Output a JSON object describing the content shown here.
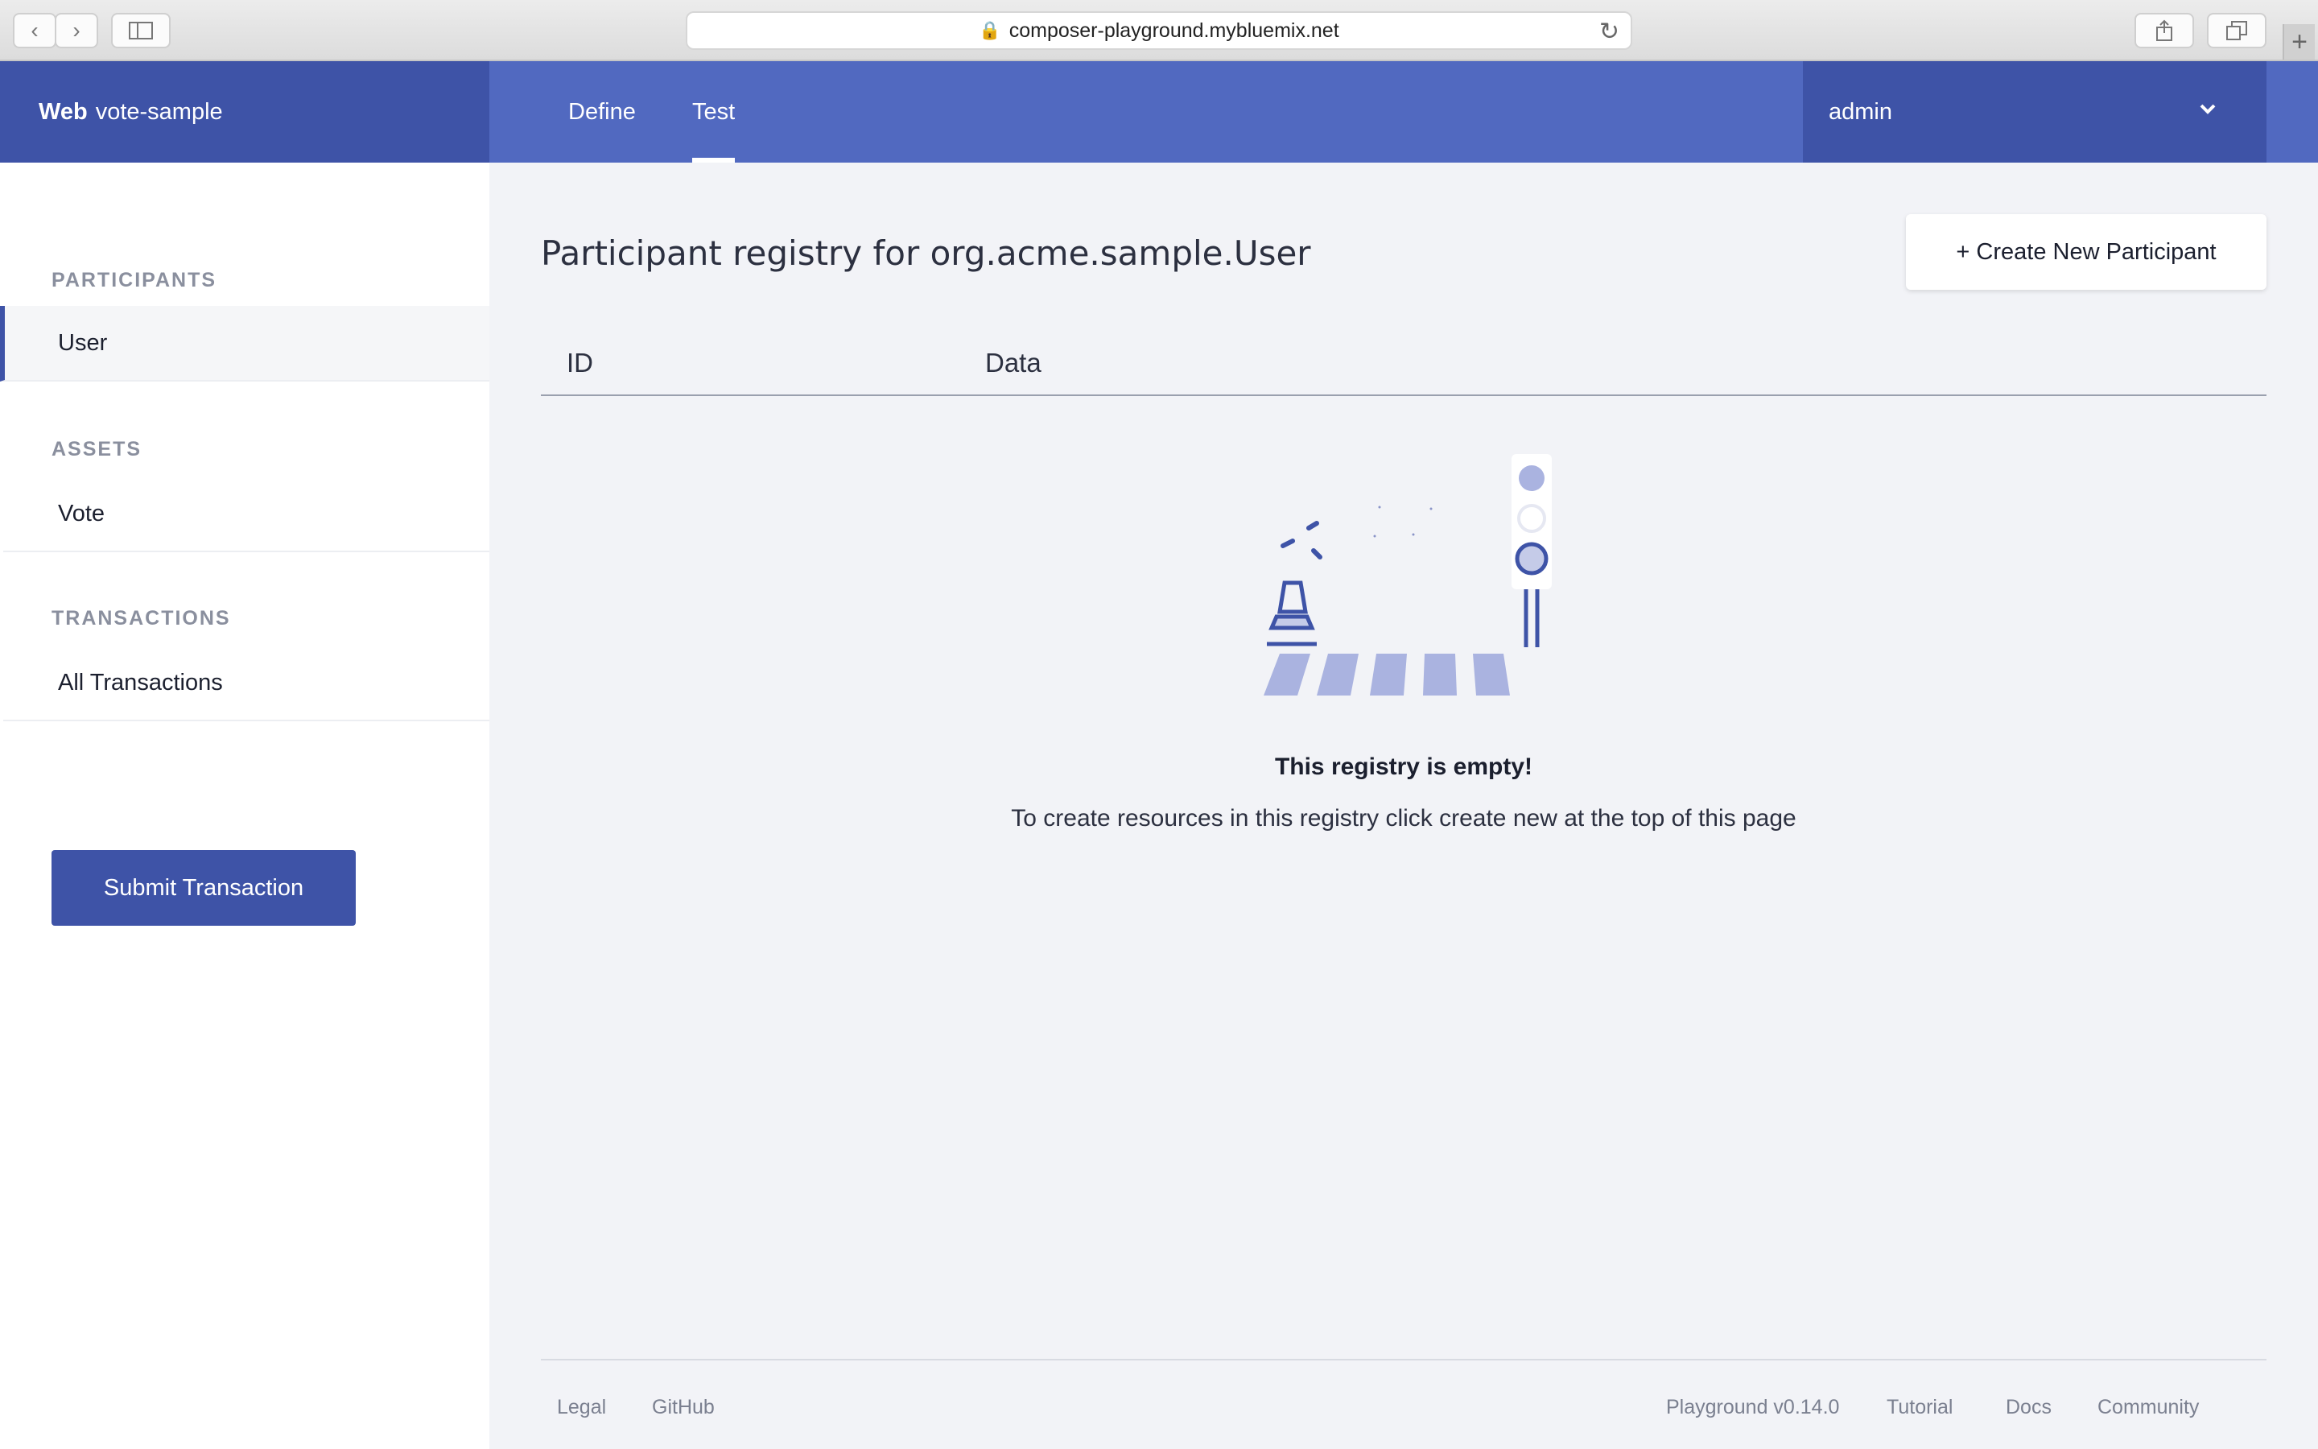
{
  "browser": {
    "url": "composer-playground.mybluemix.net",
    "back_icon": "chevron-left-icon",
    "forward_icon": "chevron-right-icon",
    "sidebar_icon": "sidebar-icon",
    "lock_icon": "lock-icon",
    "reload_icon": "reload-icon",
    "share_icon": "share-icon",
    "tabs_icon": "tabs-icon",
    "newtab_icon": "plus-icon"
  },
  "header": {
    "brand_strong": "Web",
    "brand_name": "vote-sample",
    "tabs": [
      {
        "label": "Define"
      },
      {
        "label": "Test"
      }
    ],
    "user": "admin",
    "colors": {
      "header": "#5169c0",
      "brand_bg": "#3e53a7"
    }
  },
  "sidebar": {
    "sections": [
      {
        "heading": "PARTICIPANTS",
        "items": [
          {
            "label": "User"
          }
        ]
      },
      {
        "heading": "ASSETS",
        "items": [
          {
            "label": "Vote"
          }
        ]
      },
      {
        "heading": "TRANSACTIONS",
        "items": [
          {
            "label": "All Transactions"
          }
        ]
      }
    ],
    "submit_label": "Submit Transaction"
  },
  "main": {
    "title": "Participant registry for org.acme.sample.User",
    "create_label": "+ Create New Participant",
    "columns": [
      "ID",
      "Data"
    ],
    "empty_title": "This registry is empty!",
    "empty_text": "To create resources in this registry click create new at the top of this page"
  },
  "footer": {
    "left_links": [
      "Legal",
      "GitHub"
    ],
    "version": "Playground v0.14.0",
    "right_links": [
      "Tutorial",
      "Docs",
      "Community"
    ]
  }
}
